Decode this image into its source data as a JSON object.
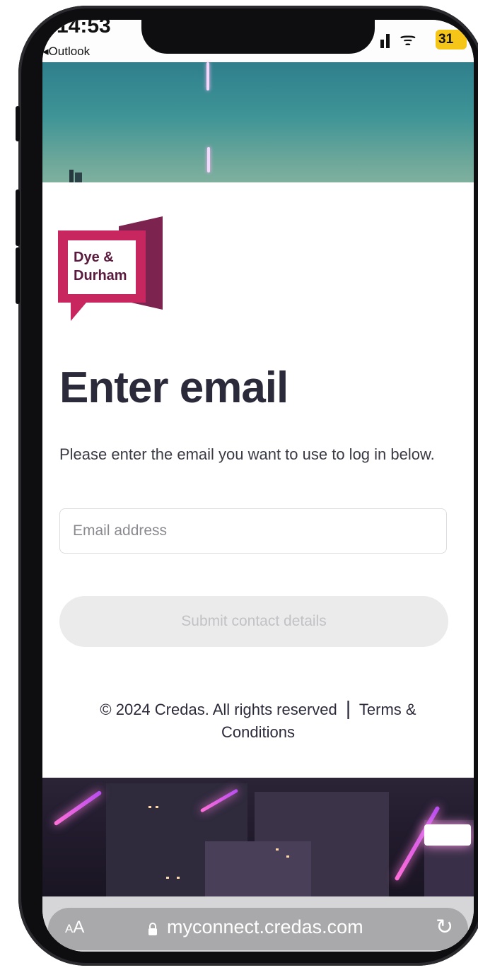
{
  "status_bar": {
    "time": "14:53",
    "back_app": "Outlook",
    "battery": "31"
  },
  "logo": {
    "text_line1": "Dye &",
    "text_line2": "Durham",
    "color_primary": "#c8265f",
    "color_secondary": "#7d2350"
  },
  "page": {
    "title": "Enter email",
    "description": "Please enter the email you want to use to log in below."
  },
  "form": {
    "email_placeholder": "Email address",
    "email_value": "",
    "submit_label": "Submit contact details"
  },
  "footer": {
    "copyright": "© 2024 Credas. All rights reserved",
    "separator": "|",
    "terms_link": "Terms & Conditions"
  },
  "browser": {
    "text_size_label_small": "A",
    "text_size_label_large": "A",
    "url": "myconnect.credas.com",
    "lock_icon": "lock-icon",
    "reload_icon": "reload-icon"
  }
}
